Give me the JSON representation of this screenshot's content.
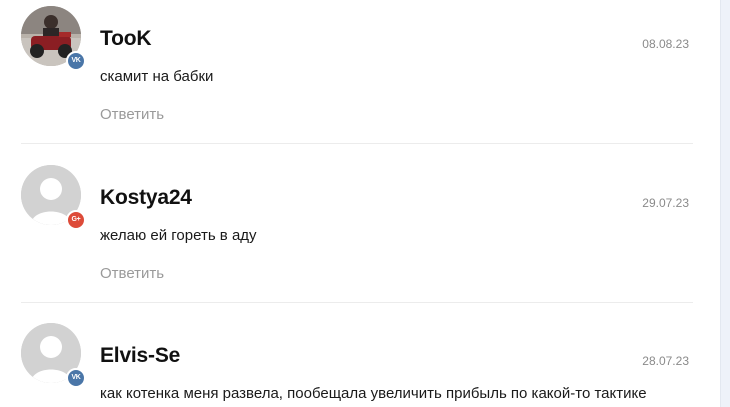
{
  "comments": [
    {
      "author": "TooK",
      "date": "08.08.23",
      "text": "скамит на бабки",
      "reply_label": "Ответить",
      "avatar_type": "photo",
      "social_icon": "vk-icon",
      "social_text": "VK"
    },
    {
      "author": "Kostya24",
      "date": "29.07.23",
      "text": "желаю ей гореть в аду",
      "reply_label": "Ответить",
      "avatar_type": "placeholder",
      "social_icon": "google-plus-icon",
      "social_text": "G+"
    },
    {
      "author": "Elvis-Se",
      "date": "28.07.23",
      "text": "как котенка меня развела, пообещала увеличить прибыль по какой-то тактике",
      "avatar_type": "placeholder",
      "social_icon": "vk-icon",
      "social_text": "VK"
    }
  ],
  "colors": {
    "vk": "#4a76a8",
    "google_plus": "#dd4b39",
    "date": "#8a8a8a",
    "reply": "#9a9a9a"
  }
}
